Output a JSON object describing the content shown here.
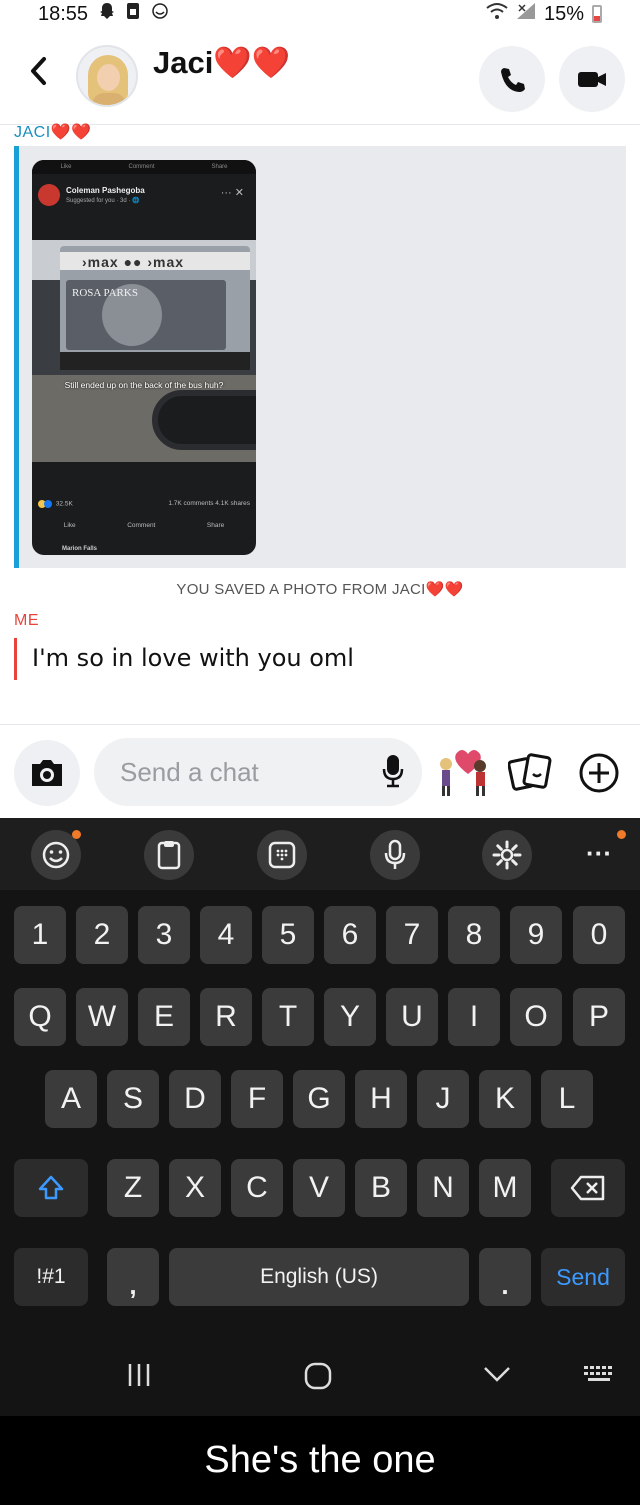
{
  "status_bar": {
    "time": "18:55",
    "battery": "15%"
  },
  "header": {
    "back_label": "<",
    "contact_name": "Jaci❤️❤️"
  },
  "chat": {
    "jaci_label": "JACI❤️❤️",
    "saved_note": "YOU SAVED A PHOTO FROM JACI❤️❤️",
    "me_label": "ME",
    "my_message": "I'm so in love with you oml",
    "post": {
      "top_actions": [
        "Like",
        "Comment",
        "Share"
      ],
      "page_name": "Coleman Pashegoba",
      "sub_line": "Suggested for you · 3d · 🌐",
      "menu": "···  ✕",
      "bus_brand": "›max  ●●  ›max",
      "poster_text": "ROSA PARKS",
      "caption": "Still ended up on the back of the bus huh?",
      "reactions": "32.5K",
      "comments_shares": "1.7K comments  4.1K shares",
      "buttons": [
        "Like",
        "Comment",
        "Share"
      ],
      "next_post": "Marion Falls"
    }
  },
  "composer": {
    "placeholder": "Send a chat",
    "value": ""
  },
  "keyboard": {
    "number_row": [
      "1",
      "2",
      "3",
      "4",
      "5",
      "6",
      "7",
      "8",
      "9",
      "0"
    ],
    "row1": [
      "Q",
      "W",
      "E",
      "R",
      "T",
      "Y",
      "U",
      "I",
      "O",
      "P"
    ],
    "row2": [
      "A",
      "S",
      "D",
      "F",
      "G",
      "H",
      "J",
      "K",
      "L"
    ],
    "row3": [
      "Z",
      "X",
      "C",
      "V",
      "B",
      "N",
      "M"
    ],
    "symbols_key": "!#1",
    "comma_key": ",",
    "space_label": "English (US)",
    "period_key": ".",
    "send_label": "Send",
    "toolbar_more": "···"
  },
  "caption": "She's the one",
  "colors": {
    "jaci": "#1a8fc0",
    "me": "#e8433b",
    "send": "#3c9aff"
  }
}
